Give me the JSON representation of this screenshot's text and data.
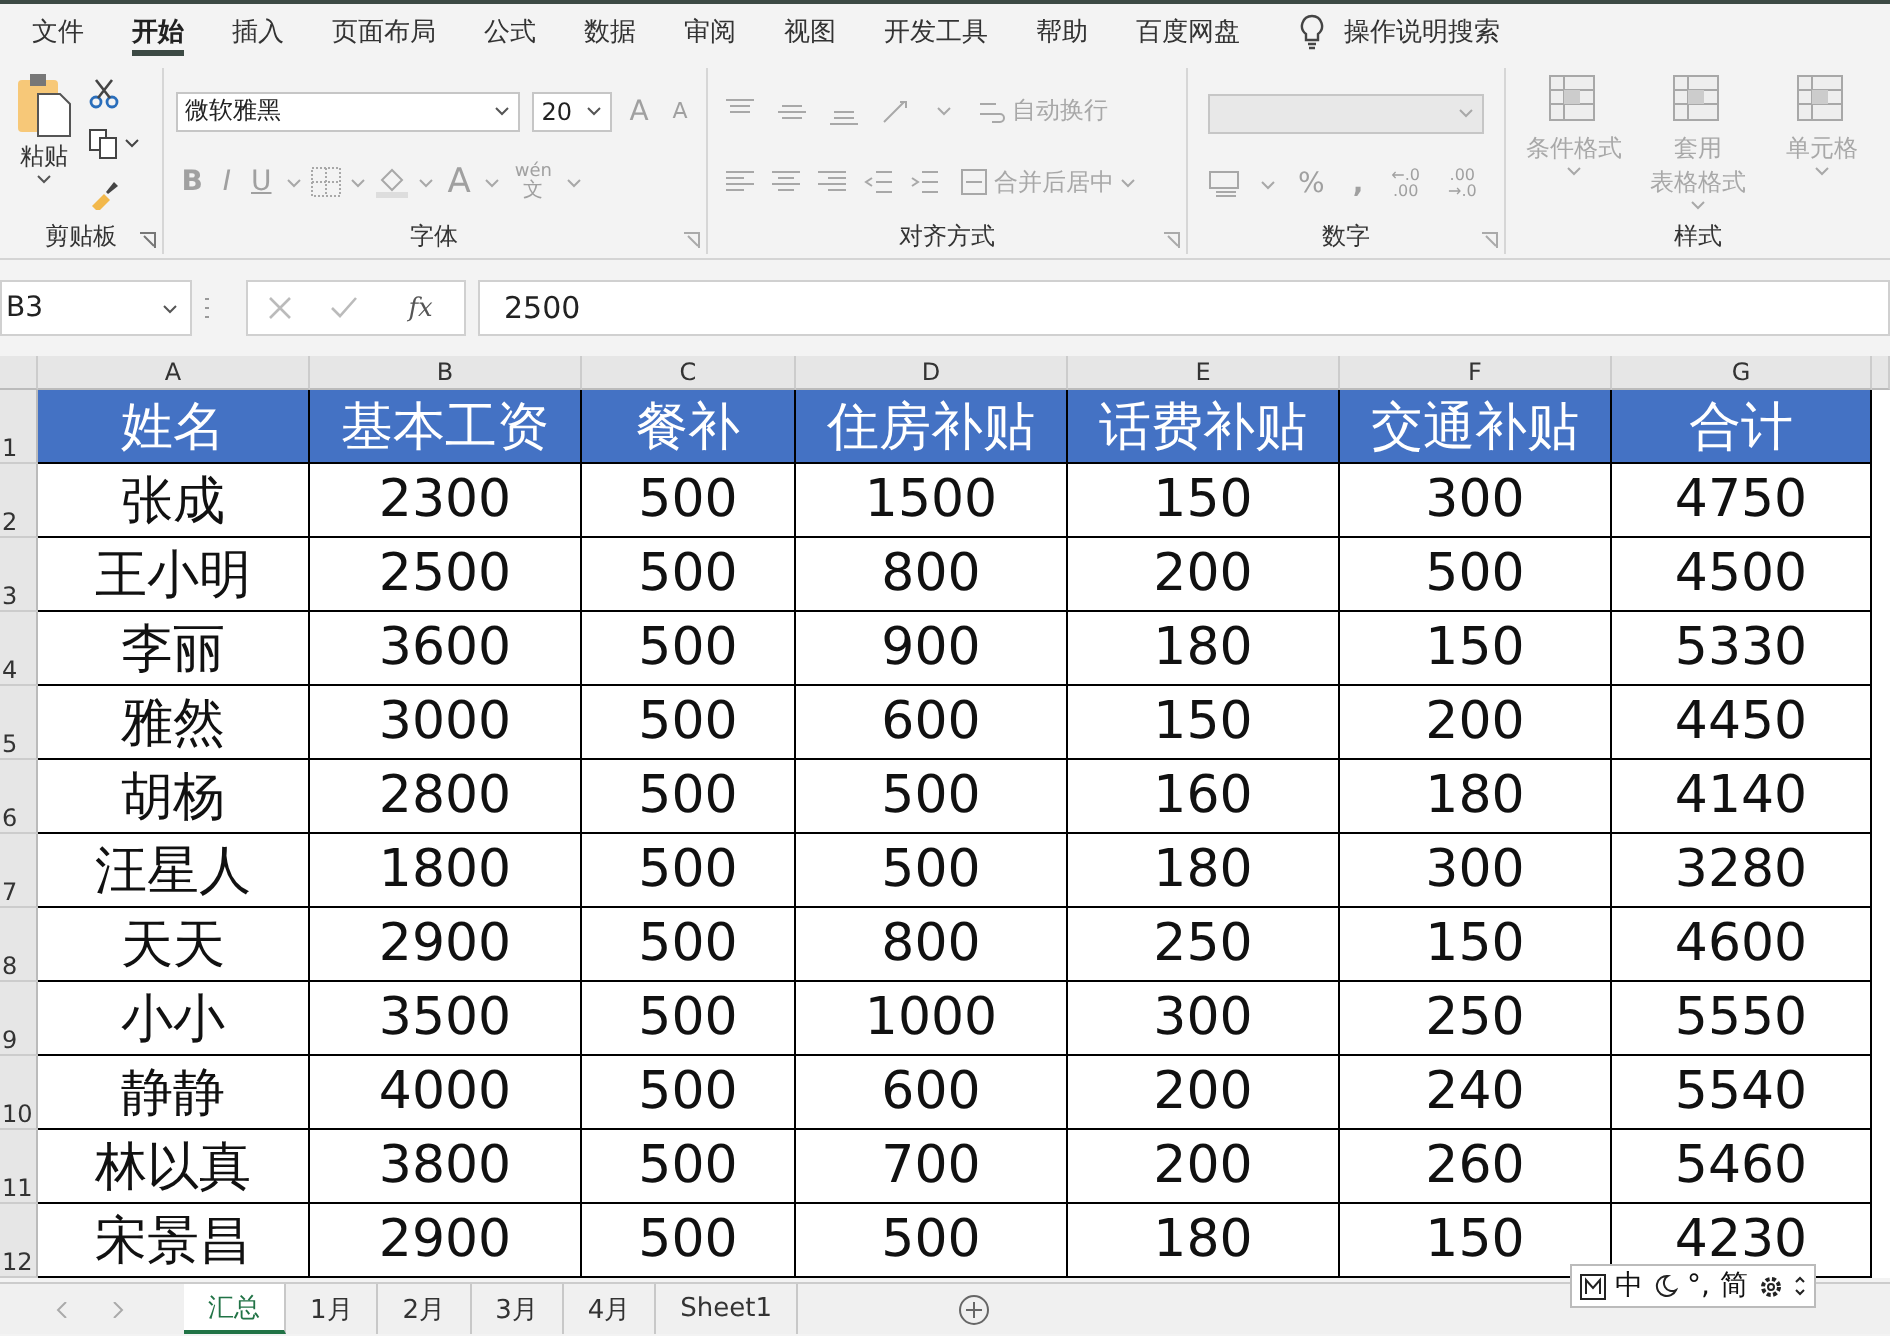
{
  "menu_tabs": [
    {
      "label": "文件",
      "selected": false
    },
    {
      "label": "开始",
      "selected": true
    },
    {
      "label": "插入",
      "selected": false
    },
    {
      "label": "页面布局",
      "selected": false
    },
    {
      "label": "公式",
      "selected": false
    },
    {
      "label": "数据",
      "selected": false
    },
    {
      "label": "审阅",
      "selected": false
    },
    {
      "label": "视图",
      "selected": false
    },
    {
      "label": "开发工具",
      "selected": false
    },
    {
      "label": "帮助",
      "selected": false
    },
    {
      "label": "百度网盘",
      "selected": false
    }
  ],
  "tell_me": "操作说明搜索",
  "ribbon": {
    "clipboard": {
      "paste": "粘贴",
      "label": "剪贴板"
    },
    "font": {
      "name": "微软雅黑",
      "size": "20",
      "grow": "A",
      "shrink": "A",
      "style_buttons": [
        "B",
        "I",
        "U"
      ],
      "color_button": "A",
      "phonetic_top": "wén",
      "phonetic_bottom": "文",
      "label": "字体"
    },
    "alignment": {
      "wrap": "自动换行",
      "merge": "合并后居中",
      "label": "对齐方式"
    },
    "number": {
      "percent": "%",
      "comma": ",",
      "increase_decimal": [
        "←.0",
        ".00"
      ],
      "decrease_decimal": [
        ".00",
        "→.0"
      ],
      "label": "数字"
    },
    "styles": {
      "buttons": [
        {
          "lines": [
            "条件格式"
          ]
        },
        {
          "lines": [
            "套用",
            "表格格式"
          ]
        },
        {
          "lines": [
            "单元格"
          ]
        }
      ],
      "label": "样式"
    }
  },
  "formula_bar": {
    "name_box": "B3",
    "function_button": "fx",
    "value": "2500"
  },
  "grid": {
    "columns": [
      "A",
      "B",
      "C",
      "D",
      "E",
      "F",
      "G"
    ],
    "rows": [
      {
        "number": "1",
        "kind": "header",
        "cells": [
          "姓名",
          "基本工资",
          "餐补",
          "住房补贴",
          "话费补贴",
          "交通补贴",
          "合计"
        ]
      },
      {
        "number": "2",
        "kind": "data",
        "cells": [
          "张成",
          "2300",
          "500",
          "1500",
          "150",
          "300",
          "4750"
        ]
      },
      {
        "number": "3",
        "kind": "data",
        "cells": [
          "王小明",
          "2500",
          "500",
          "800",
          "200",
          "500",
          "4500"
        ]
      },
      {
        "number": "4",
        "kind": "data",
        "cells": [
          "李丽",
          "3600",
          "500",
          "900",
          "180",
          "150",
          "5330"
        ]
      },
      {
        "number": "5",
        "kind": "data",
        "cells": [
          "雅然",
          "3000",
          "500",
          "600",
          "150",
          "200",
          "4450"
        ]
      },
      {
        "number": "6",
        "kind": "data",
        "cells": [
          "胡杨",
          "2800",
          "500",
          "500",
          "160",
          "180",
          "4140"
        ]
      },
      {
        "number": "7",
        "kind": "data",
        "cells": [
          "汪星人",
          "1800",
          "500",
          "500",
          "180",
          "300",
          "3280"
        ]
      },
      {
        "number": "8",
        "kind": "data",
        "cells": [
          "天天",
          "2900",
          "500",
          "800",
          "250",
          "150",
          "4600"
        ]
      },
      {
        "number": "9",
        "kind": "data",
        "cells": [
          "小小",
          "3500",
          "500",
          "1000",
          "300",
          "250",
          "5550"
        ]
      },
      {
        "number": "10",
        "kind": "data",
        "cells": [
          "静静",
          "4000",
          "500",
          "600",
          "200",
          "240",
          "5540"
        ]
      },
      {
        "number": "11",
        "kind": "data",
        "cells": [
          "林以真",
          "3800",
          "500",
          "700",
          "200",
          "260",
          "5460"
        ]
      },
      {
        "number": "12",
        "kind": "data",
        "cells": [
          "宋景昌",
          "2900",
          "500",
          "500",
          "180",
          "150",
          "4230"
        ]
      }
    ]
  },
  "sheet_tabs": [
    {
      "label": "汇总",
      "selected": true
    },
    {
      "label": "1月",
      "selected": false
    },
    {
      "label": "2月",
      "selected": false
    },
    {
      "label": "3月",
      "selected": false
    },
    {
      "label": "4月",
      "selected": false
    },
    {
      "label": "Sheet1",
      "selected": false
    }
  ],
  "ime_toolbar": {
    "mode": "中",
    "punctuation": "°,",
    "script": "简"
  }
}
